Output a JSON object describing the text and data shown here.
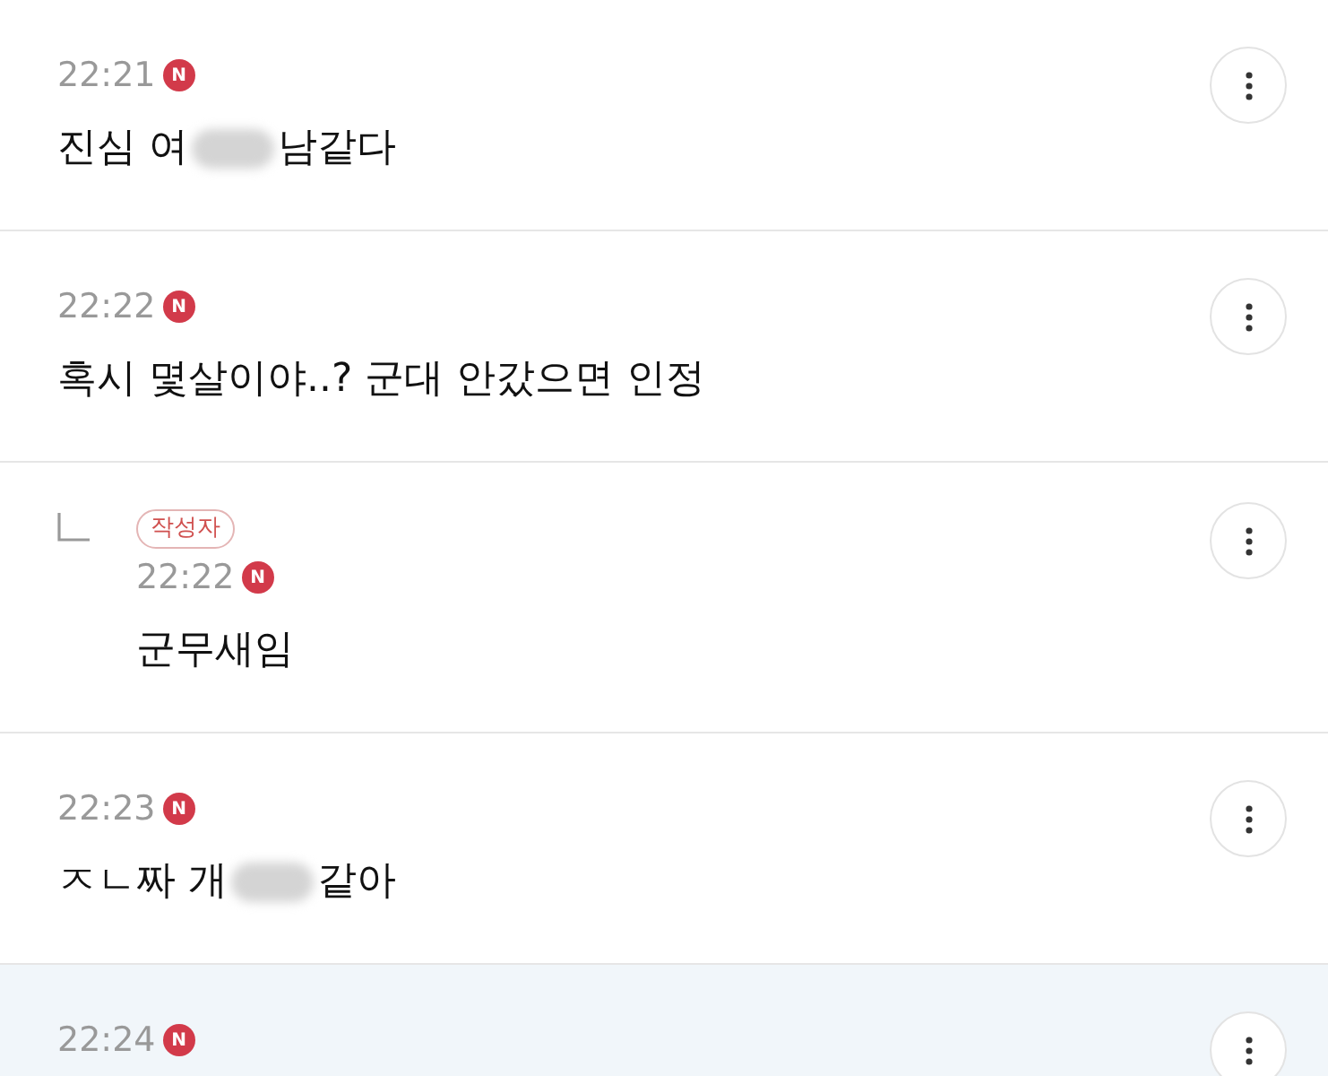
{
  "comments": [
    {
      "kind": "comment",
      "time": "22:21",
      "new_badge": "N",
      "text_parts": [
        "진심 여",
        "남같다"
      ],
      "highlighted": false
    },
    {
      "kind": "comment",
      "time": "22:22",
      "new_badge": "N",
      "text_parts": [
        "혹시 몇살이야..? 군대 안갔으면 인정"
      ],
      "highlighted": false
    },
    {
      "kind": "reply",
      "author_badge": "작성자",
      "time": "22:22",
      "new_badge": "N",
      "text_parts": [
        "군무새임"
      ],
      "highlighted": false
    },
    {
      "kind": "comment",
      "time": "22:23",
      "new_badge": "N",
      "text_parts": [
        "ㅈㄴ짜 개",
        "같아"
      ],
      "highlighted": false
    },
    {
      "kind": "comment",
      "time": "22:24",
      "new_badge": "N",
      "highlighted": true
    }
  ]
}
